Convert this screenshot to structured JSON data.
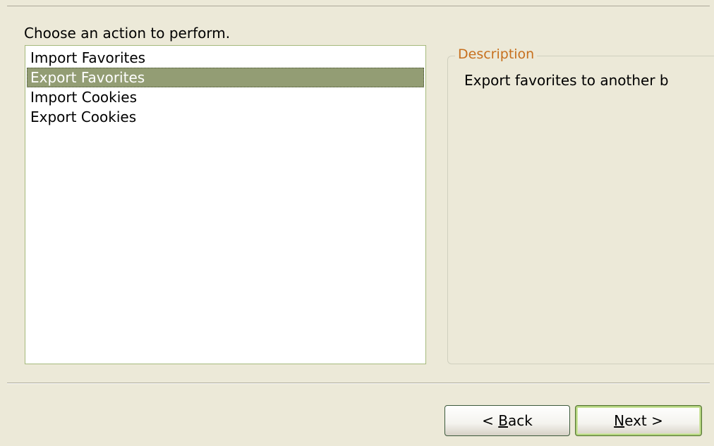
{
  "prompt": "Choose an action to perform.",
  "actions": {
    "items": [
      {
        "label": "Import Favorites",
        "selected": false
      },
      {
        "label": "Export Favorites",
        "selected": true
      },
      {
        "label": "Import Cookies",
        "selected": false
      },
      {
        "label": "Export Cookies",
        "selected": false
      }
    ]
  },
  "description": {
    "legend": "Description",
    "text": "Export favorites to another b"
  },
  "buttons": {
    "back": {
      "prefix": "< ",
      "mnemonic": "B",
      "rest": "ack"
    },
    "next": {
      "prefix": "",
      "mnemonic": "N",
      "rest": "ext >"
    }
  },
  "colors": {
    "background": "#ece9d8",
    "selection": "#939d74",
    "legend": "#c7701e"
  }
}
